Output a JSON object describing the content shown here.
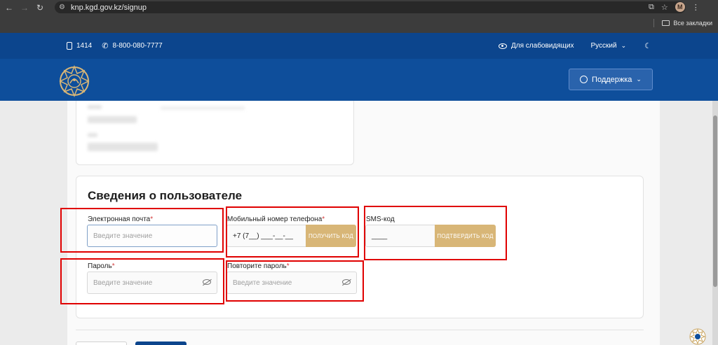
{
  "browser": {
    "url": "knp.kgd.gov.kz/signup",
    "avatar_letter": "M",
    "bookmarks_label": "Все закладки"
  },
  "topbar": {
    "short_number": "1414",
    "phone": "8-800-080-7777",
    "accessibility": "Для слабовидящих",
    "language": "Русский"
  },
  "header": {
    "support": "Поддержка"
  },
  "user_section": {
    "title": "Сведения о пользователе",
    "email": {
      "label": "Электронная почта",
      "placeholder": "Введите значение"
    },
    "phone": {
      "label": "Мобильный номер телефона",
      "value": "+7 (7__) ___-__-__",
      "button": "ПОЛУЧИТЬ КОД"
    },
    "sms": {
      "label": "SMS-код",
      "value": "____",
      "button": "ПОДТВЕРДИТЬ КОД"
    },
    "password": {
      "label": "Пароль",
      "placeholder": "Введите значение"
    },
    "password_repeat": {
      "label": "Повторите пароль",
      "placeholder": "Введите значение"
    },
    "required_mark": "*"
  },
  "colors": {
    "brand_blue": "#0c458d",
    "gold": "#d8b677",
    "highlight": "#e00000"
  }
}
